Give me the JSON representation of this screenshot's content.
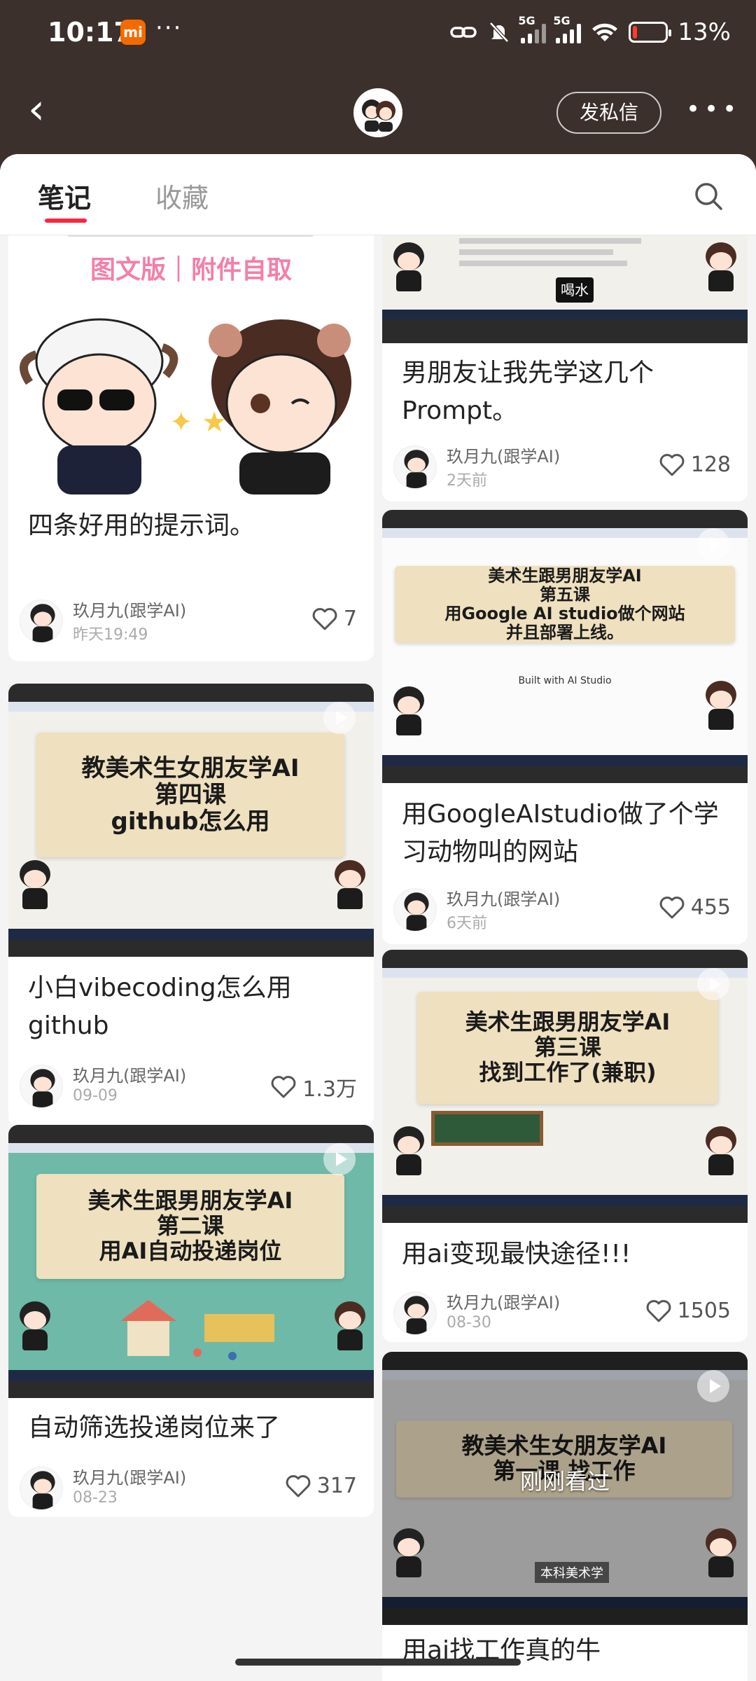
{
  "status": {
    "time": "10:17",
    "mi": "mi",
    "dots": "···",
    "net1": "5G",
    "net2": "5G",
    "battery": "13%",
    "battery_level": 0.13
  },
  "nav": {
    "back": "‹",
    "dm_button": "发私信",
    "more": "•••"
  },
  "tabs": [
    {
      "label": "笔记",
      "active": true
    },
    {
      "label": "收藏",
      "active": false
    }
  ],
  "colors": {
    "accent": "#ff2442",
    "header_bg": "#3b302b",
    "feed_bg": "#f4f4f4",
    "paper": "#efe0bf"
  },
  "cards": [
    {
      "title": "四条好用的提示词。",
      "banner": "图文版｜附件自取",
      "author": "玖月九(跟学AI)",
      "date": "昨天19:49",
      "likes": "7"
    },
    {
      "title": "小白vibecoding怎么用github",
      "cover_lines": [
        "教美术生女朋友学AI",
        "第四课",
        "github怎么用"
      ],
      "author": "玖月九(跟学AI)",
      "date": "09-09",
      "likes": "1.3万"
    },
    {
      "title": "自动筛选投递岗位来了",
      "cover_lines": [
        "美术生跟男朋友学AI",
        "第二课",
        "用AI自动投递岗位"
      ],
      "author": "玖月九(跟学AI)",
      "date": "08-23",
      "likes": "317"
    },
    {
      "title": "男朋友让我先学这几个Prompt。",
      "cover_badge": "喝水",
      "author": "玖月九(跟学AI)",
      "date": "2天前",
      "likes": "128"
    },
    {
      "title": "用GoogleAIstudio做了个学习动物叫的网站",
      "cover_lines": [
        "美术生跟男朋友学AI",
        "第五课",
        "用Google AI studio做个网站",
        "并且部署上线。"
      ],
      "cover_sub": "Built with AI Studio",
      "author": "玖月九(跟学AI)",
      "date": "6天前",
      "likes": "455"
    },
    {
      "title": "用ai变现最快途径!!!",
      "cover_lines": [
        "美术生跟男朋友学AI",
        "第三课",
        "找到工作了(兼职)"
      ],
      "author": "玖月九(跟学AI)",
      "date": "08-30",
      "likes": "1505"
    },
    {
      "title": "用ai找工作真的牛",
      "cover_lines": [
        "教美术生女朋友学AI",
        "第一课 找工作"
      ],
      "overlay": "刚刚看过",
      "caption": "本科美术学"
    }
  ]
}
